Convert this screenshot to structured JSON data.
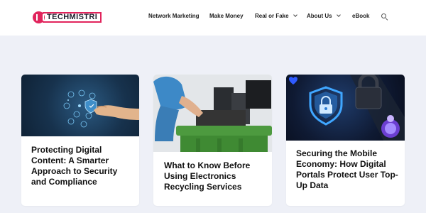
{
  "site": {
    "logo_text": "TECHMISTRI"
  },
  "nav": {
    "items": [
      {
        "label": "Network Marketing",
        "has_dropdown": false
      },
      {
        "label": "Make Money",
        "has_dropdown": false
      },
      {
        "label": "Real or Fake",
        "has_dropdown": true
      },
      {
        "label": "About Us",
        "has_dropdown": true
      },
      {
        "label": "eBook",
        "has_dropdown": false
      }
    ],
    "search_icon": "search-icon"
  },
  "posts": [
    {
      "title": "Protecting Digital Content: A Smarter Approach to Security and Compliance",
      "image_icon": "security-network-image"
    },
    {
      "title": "What to Know Before Using Electronics Recycling Services",
      "image_icon": "electronics-recycling-image"
    },
    {
      "title": "Securing the Mobile Economy: How Digital Portals Protect User Top-Up Data",
      "image_icon": "mobile-security-image"
    }
  ],
  "colors": {
    "brand": "#e1245c",
    "page_bg": "#eef0f7",
    "card_bg": "#ffffff",
    "text": "#111111"
  }
}
